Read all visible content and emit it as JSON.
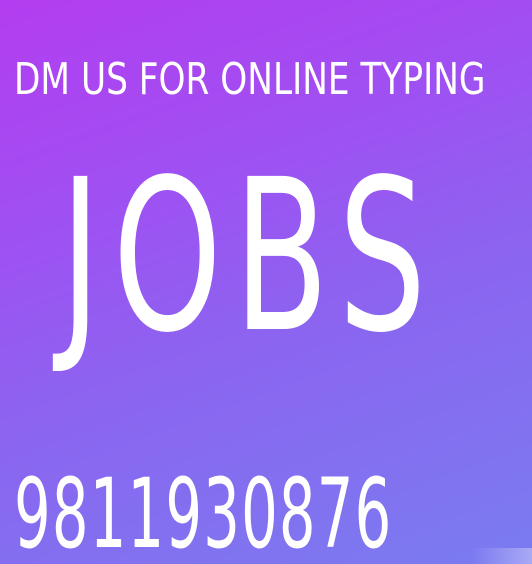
{
  "headline": "DM US FOR ONLINE TYPING",
  "main_word": "JOBS",
  "phone_number": "9811930876",
  "colors": {
    "gradient_start": "#b33df0",
    "gradient_end": "#7a7cf0",
    "text": "#ffffff"
  }
}
